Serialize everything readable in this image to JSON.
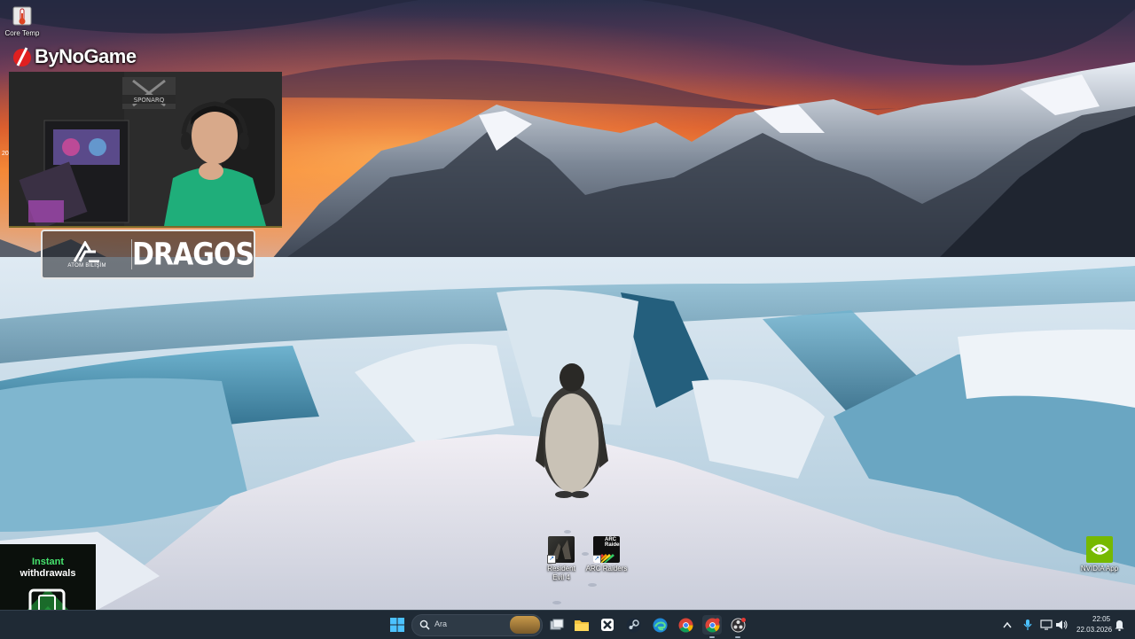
{
  "desktop": {
    "icons": [
      {
        "name": "core-temp",
        "label": "Core Temp"
      },
      {
        "name": "resident-evil-4",
        "label": "Resident Evil 4"
      },
      {
        "name": "arc-raiders",
        "label": "ARC Raiders",
        "art_text": "ARC Raiders"
      },
      {
        "name": "nvidia-app",
        "label": "NVIDIA App"
      }
    ]
  },
  "overlay": {
    "brand": "ByNoGame",
    "sponsor_left_caption": "ATOM BİLİŞİM",
    "sponsor_right": "DRAGOS",
    "webcam_sign": "SPONARQ",
    "side_text": "20",
    "promo_line1": "Instant",
    "promo_line2": "withdrawals",
    "promo_footer": "Va"
  },
  "taskbar": {
    "search_placeholder": "Ara",
    "apps": [
      "start-icon",
      "search-icon",
      "task-view-icon",
      "file-explorer-icon",
      "xbox-app-icon",
      "steam-icon",
      "edge-icon",
      "chrome-icon",
      "chrome-beta-icon",
      "obs-icon"
    ],
    "clock_time": "22:05",
    "clock_date": "22.03.2026"
  },
  "colors": {
    "taskbar": "#1f2a35",
    "accent_green": "#46e36e",
    "nvidia_green": "#76b900"
  }
}
